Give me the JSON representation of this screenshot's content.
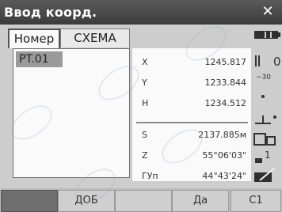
{
  "window": {
    "title": "Ввод коорд.",
    "close_symbol": "✕"
  },
  "tabs": [
    {
      "label": "Номер",
      "active": true
    },
    {
      "label": "СХЕМА",
      "active": false
    }
  ],
  "list": {
    "items": [
      "PT.01"
    ]
  },
  "measurements": [
    {
      "label": "X",
      "value": "1245.817"
    },
    {
      "label": "Y",
      "value": "1233.844"
    },
    {
      "label": "H",
      "value": "1234.512"
    },
    {
      "label": "S",
      "value": "2137.885м"
    },
    {
      "label": "Z",
      "value": "55°06'03\""
    },
    {
      "label": "ГУп",
      "value": "44°43'24\""
    }
  ],
  "side_status": {
    "battery_icon": "battery-icon",
    "target_symbol": "0",
    "prism_constant": "−30",
    "tilt_icon": "tilt-icon",
    "laser_icon": "laser-icon",
    "page_number": "1",
    "pen_icon": "input-mode-icon"
  },
  "softkeys": [
    "",
    "ДОБ",
    "",
    "Да",
    "С1"
  ],
  "colors": {
    "title_bar": "#4a4a4a",
    "softkey_dark": "#6e6e6e",
    "list_selection": "#9a9a9a"
  }
}
